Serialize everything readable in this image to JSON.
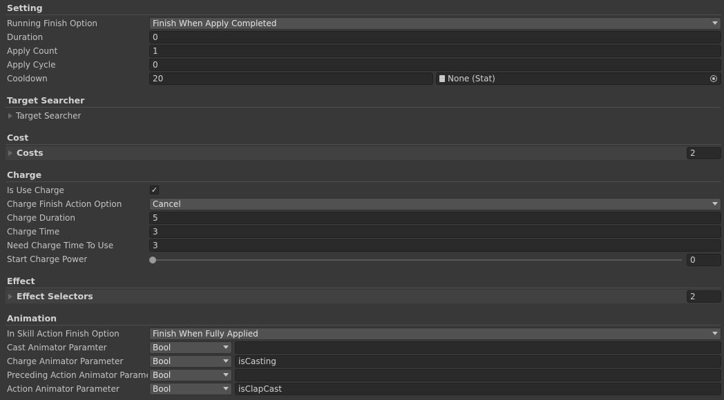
{
  "setting": {
    "header": "Setting",
    "running_finish_option": {
      "label": "Running Finish Option",
      "value": "Finish When Apply Completed"
    },
    "duration": {
      "label": "Duration",
      "value": "0"
    },
    "apply_count": {
      "label": "Apply Count",
      "value": "1"
    },
    "apply_cycle": {
      "label": "Apply Cycle",
      "value": "0"
    },
    "cooldown": {
      "label": "Cooldown",
      "value": "20",
      "stat_ref": "None (Stat)"
    }
  },
  "target_searcher": {
    "header": "Target Searcher",
    "foldout_label": "Target Searcher"
  },
  "cost": {
    "header": "Cost",
    "costs": {
      "label": "Costs",
      "count": "2"
    }
  },
  "charge": {
    "header": "Charge",
    "is_use_charge": {
      "label": "Is Use Charge",
      "checked": true,
      "mark": "✓"
    },
    "charge_finish_action_option": {
      "label": "Charge Finish Action Option",
      "value": "Cancel"
    },
    "charge_duration": {
      "label": "Charge Duration",
      "value": "5"
    },
    "charge_time": {
      "label": "Charge Time",
      "value": "3"
    },
    "need_charge_time_to_use": {
      "label": "Need Charge Time To Use",
      "value": "3"
    },
    "start_charge_power": {
      "label": "Start Charge Power",
      "value": "0",
      "slider_fraction": 0
    }
  },
  "effect": {
    "header": "Effect",
    "effect_selectors": {
      "label": "Effect Selectors",
      "count": "2"
    }
  },
  "animation": {
    "header": "Animation",
    "in_skill_action_finish_option": {
      "label": "In Skill Action Finish Option",
      "value": "Finish When Fully Applied"
    },
    "cast_animator_paramter": {
      "label": "Cast Animator Paramter",
      "type": "Bool",
      "value": ""
    },
    "charge_animator_parameter": {
      "label": "Charge Animator Parameter",
      "type": "Bool",
      "value": "isCasting"
    },
    "preceding_action_animator_parameter": {
      "label": "Preceding Action Animator Paramete",
      "type": "Bool",
      "value": ""
    },
    "action_animator_parameter": {
      "label": "Action Animator Parameter",
      "type": "Bool",
      "value": "isClapCast"
    }
  }
}
